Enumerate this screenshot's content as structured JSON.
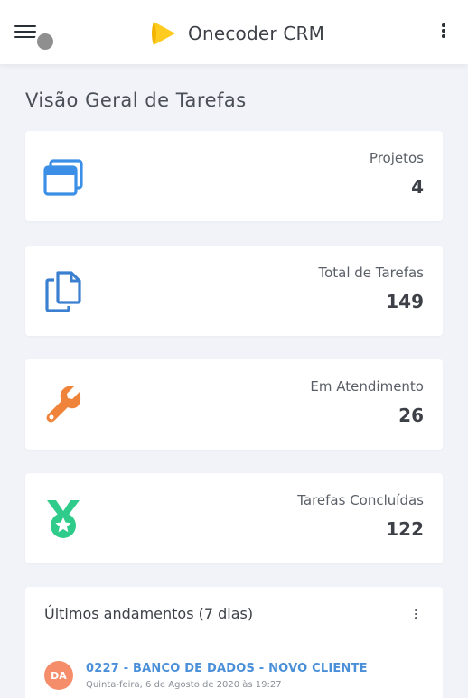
{
  "header": {
    "app_name": "Onecoder CRM",
    "brand_color": "#FFCB1F",
    "menu_icon": "hamburger-icon",
    "more_icon": "kebab-menu-icon"
  },
  "page": {
    "title": "Visão Geral de Tarefas"
  },
  "stats": [
    {
      "label": "Projetos",
      "value": "4",
      "icon": "windows-icon",
      "color": "#3b8fe6"
    },
    {
      "label": "Total de Tarefas",
      "value": "149",
      "icon": "copy-icon",
      "color": "#3b7fd0"
    },
    {
      "label": "Em Atendimento",
      "value": "26",
      "icon": "wrench-icon",
      "color": "#f0833a"
    },
    {
      "label": "Tarefas Concluídas",
      "value": "122",
      "icon": "medal-icon",
      "color": "#2fcb8a"
    }
  ],
  "activity": {
    "title": "Últimos andamentos (7 dias)",
    "items": [
      {
        "avatar": "DA",
        "avatar_color": "#f58d6b",
        "title": "0227 - BANCO DE DADOS - NOVO CLIENTE",
        "date": "Quinta-feira, 6 de Agosto de 2020 às 19:27"
      }
    ]
  }
}
